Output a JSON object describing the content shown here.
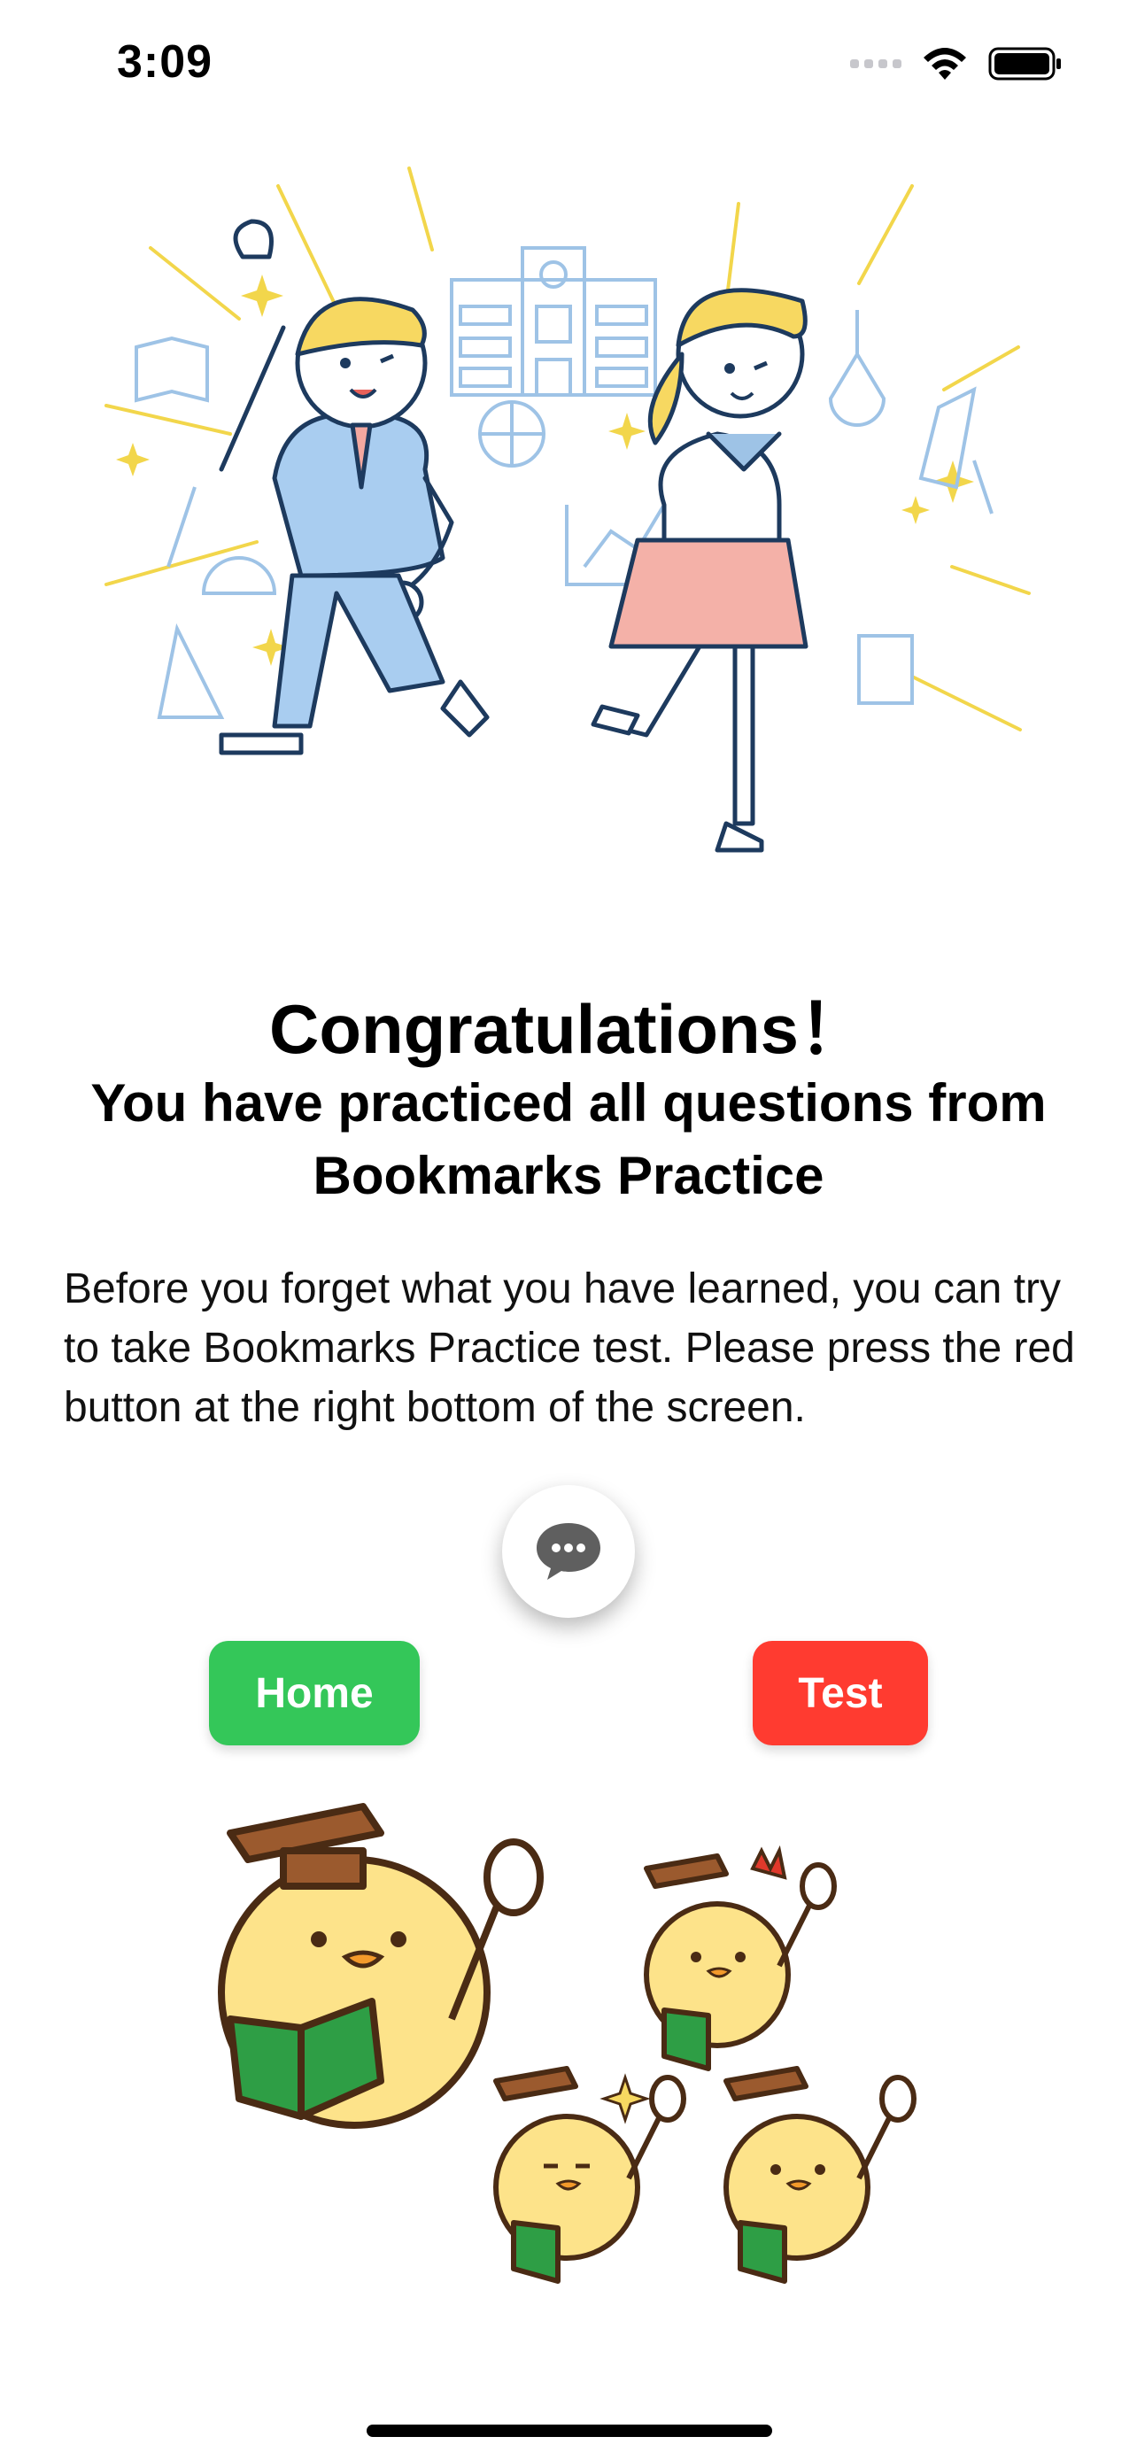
{
  "status_bar": {
    "time": "3:09"
  },
  "congrats": {
    "title": "Congratulations！",
    "subtitle": "You have practiced all questions from Bookmarks Practice",
    "body": "Before you forget what you have learned, you can try to take Bookmarks Practice  test. Please press the red button at the right bottom of the screen."
  },
  "actions": {
    "home_label": "Home",
    "test_label": "Test"
  },
  "icons": {
    "chat": "chat-bubble-icon"
  },
  "colors": {
    "home_button": "#34c759",
    "test_button": "#ff3b30"
  }
}
